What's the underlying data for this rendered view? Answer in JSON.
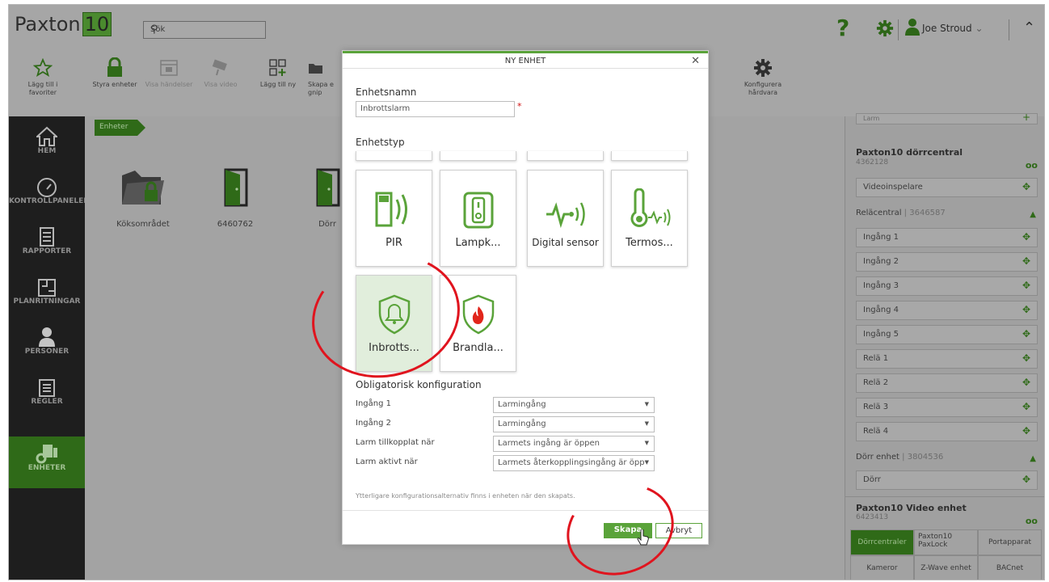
{
  "app": {
    "logo_text": "Paxton",
    "logo_num": "10",
    "search_placeholder": "Sök",
    "user_name": "Joe Stroud"
  },
  "toolbar": [
    {
      "label": "Lägg till i favoriter"
    },
    {
      "label": "Styra enheter"
    },
    {
      "label": "Visa händelser"
    },
    {
      "label": "Visa video"
    },
    {
      "label": "Lägg till ny"
    },
    {
      "label": "Skapa e gnip"
    },
    {
      "label": "Konfigurera hårdvara"
    }
  ],
  "leftnav": [
    {
      "label": "HEM"
    },
    {
      "label": "KONTROLLPANELER"
    },
    {
      "label": "RAPPORTER"
    },
    {
      "label": "PLANRITNINGAR"
    },
    {
      "label": "PERSONER"
    },
    {
      "label": "REGLER"
    },
    {
      "label": "ENHETER"
    }
  ],
  "breadcrumb": "Enheter",
  "content_items": [
    {
      "label": "Köksområdet"
    },
    {
      "label": "6460762"
    },
    {
      "label": "Dörr"
    }
  ],
  "modal": {
    "title": "NY ENHET",
    "name_label": "Enhetsnamn",
    "name_value": "Inbrottslarm",
    "type_label": "Enhetstyp",
    "tiles": [
      {
        "name": "PIR"
      },
      {
        "name": "Lampk..."
      },
      {
        "name": "Digital sensor"
      },
      {
        "name": "Termos..."
      },
      {
        "name": "Inbrotts..."
      },
      {
        "name": "Brandla..."
      }
    ],
    "config_title": "Obligatorisk konfiguration",
    "config": [
      {
        "label": "Ingång 1",
        "value": "Larmingång"
      },
      {
        "label": "Ingång 2",
        "value": "Larmingång"
      },
      {
        "label": "Larm tillkopplat när",
        "value": "Larmets ingång är öppen"
      },
      {
        "label": "Larm aktivt när",
        "value": "Larmets återkopplingsingång är öppe"
      }
    ],
    "note": "Ytterligare konfigurationsalternativ finns i enheten när den skapats.",
    "create": "Skapa",
    "cancel": "Avbryt"
  },
  "rightpanel": {
    "top_partial": "Larm",
    "controller_title": "Paxton10 dörrcentral",
    "controller_id": "4362128",
    "video_recorder": "Videoinspelare",
    "relay_title": "Reläcentral",
    "relay_id": "3646587",
    "relay_rows": [
      "Ingång 1",
      "Ingång 2",
      "Ingång 3",
      "Ingång 4",
      "Ingång 5",
      "Relä 1",
      "Relä 2",
      "Relä 3",
      "Relä 4"
    ],
    "door_title": "Dörr enhet",
    "door_id": "3804536",
    "door_row": "Dörr",
    "video_title": "Paxton10 Video enhet",
    "video_id": "6423413",
    "tabs": [
      {
        "label": "Dörrcentraler"
      },
      {
        "label": "Paxton10 PaxLock"
      },
      {
        "label": "Portapparat"
      },
      {
        "label": "Kameror"
      },
      {
        "label": "Z-Wave enhet"
      },
      {
        "label": "BACnet"
      }
    ]
  },
  "colors": {
    "accent": "#5aa33a",
    "dark_green": "#2f6a18",
    "annotation": "#e0141e"
  }
}
